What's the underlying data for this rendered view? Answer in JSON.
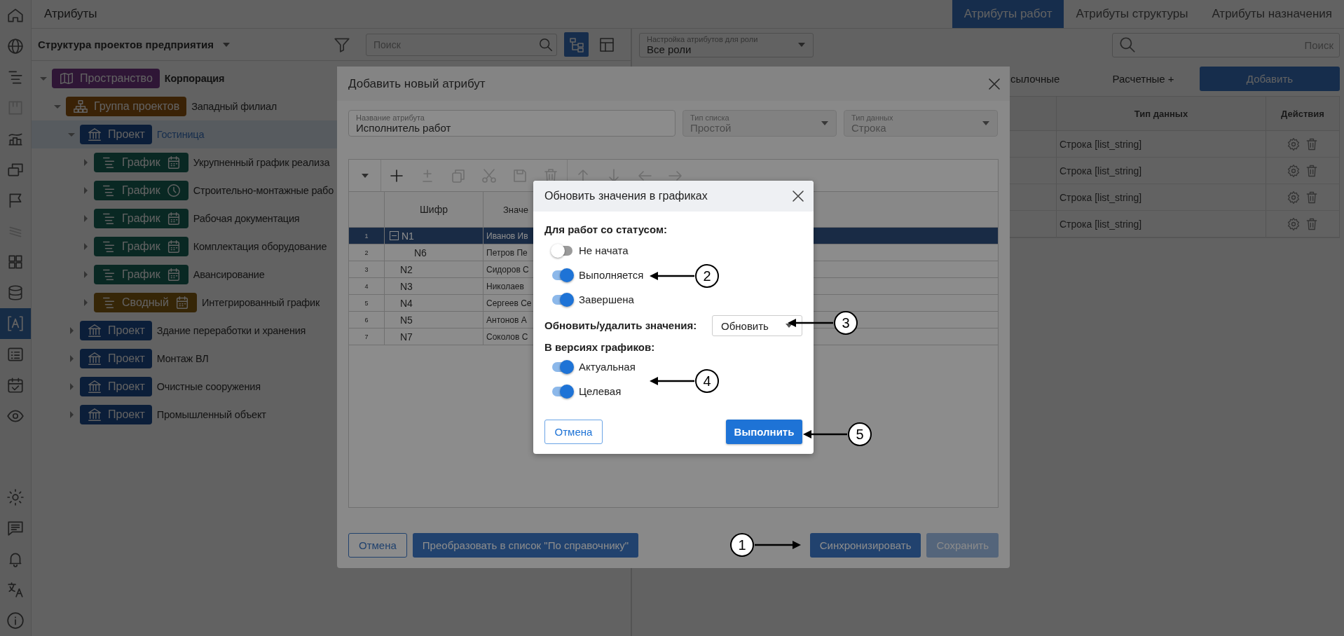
{
  "header": {
    "title": "Атрибуты",
    "tabs": [
      {
        "label": "Атрибуты работ",
        "selected": true
      },
      {
        "label": "Атрибуты структуры",
        "selected": false
      },
      {
        "label": "Атрибуты назначения",
        "selected": false
      }
    ]
  },
  "sidebar": {
    "items": [
      {
        "selected": false,
        "disabled": false
      },
      {
        "selected": false,
        "disabled": false
      },
      {
        "selected": false,
        "disabled": false
      },
      {
        "selected": false,
        "disabled": true
      },
      {
        "selected": false,
        "disabled": false
      },
      {
        "selected": false,
        "disabled": false
      },
      {
        "selected": false,
        "disabled": false
      },
      {
        "selected": false,
        "disabled": true
      },
      {
        "selected": false,
        "disabled": false
      },
      {
        "selected": false,
        "disabled": false
      },
      {
        "selected": true,
        "disabled": false
      },
      {
        "selected": false,
        "disabled": false
      },
      {
        "selected": false,
        "disabled": false
      },
      {
        "selected": false,
        "disabled": false
      }
    ]
  },
  "left_panel": {
    "structure_selector": "Структура проектов предприятия",
    "search": {
      "placeholder": "Поиск"
    },
    "view_toggle": [
      {
        "selected": true
      },
      {
        "selected": false
      }
    ],
    "tree": [
      {
        "kind": "space",
        "badge": "Пространство",
        "label": "Корпорация",
        "expanded": true,
        "selected": false,
        "children": [
          {
            "kind": "group",
            "badge": "Группа проектов",
            "label": "Западный филиал",
            "expanded": true,
            "selected": false,
            "children": [
              {
                "kind": "project",
                "badge": "Проект",
                "label": "Гостиница",
                "expanded": true,
                "selected": true,
                "children": [
                  {
                    "kind": "schedule",
                    "badge": "График",
                    "label": "Укрупненный график реализа",
                    "expanded": false,
                    "selected": false
                  },
                  {
                    "kind": "schedule-clock",
                    "badge": "График",
                    "label": "Строительно-монтажные рабо",
                    "expanded": false,
                    "selected": false
                  },
                  {
                    "kind": "schedule",
                    "badge": "График",
                    "label": "Рабочая документация",
                    "expanded": false,
                    "selected": false
                  },
                  {
                    "kind": "schedule",
                    "badge": "График",
                    "label": "Комплектация оборудование",
                    "expanded": false,
                    "selected": false
                  },
                  {
                    "kind": "schedule",
                    "badge": "График",
                    "label": "Авансирование",
                    "expanded": false,
                    "selected": false
                  },
                  {
                    "kind": "summary",
                    "badge": "Сводный",
                    "label": "Интегрированный график",
                    "expanded": false,
                    "selected": false
                  }
                ]
              },
              {
                "kind": "project",
                "badge": "Проект",
                "label": "Здание переработки и хранения",
                "expanded": false,
                "selected": false
              },
              {
                "kind": "project",
                "badge": "Проект",
                "label": "Монтаж ВЛ",
                "expanded": false,
                "selected": false
              },
              {
                "kind": "project",
                "badge": "Проект",
                "label": "Очистные сооружения",
                "expanded": false,
                "selected": false
              },
              {
                "kind": "project",
                "badge": "Проект",
                "label": "Промышленный объект",
                "expanded": false,
                "selected": false
              }
            ]
          }
        ]
      }
    ]
  },
  "right_panel": {
    "role_filter": {
      "label": "Настройка атрибутов для роли",
      "value": "Все роли"
    },
    "search": {
      "placeholder": "Поиск"
    },
    "filters": [
      "сылочные",
      "Расчетные +"
    ],
    "add_button": "Добавить",
    "table": {
      "columns": [
        "Тип данных",
        "Действия"
      ],
      "rows": [
        {
          "data_type": "Строка [list_string]"
        },
        {
          "data_type": "Строка [list_string]"
        },
        {
          "data_type": "Строка [list_string]"
        },
        {
          "data_type": "Строка [list_string]"
        }
      ]
    }
  },
  "attribute_dialog": {
    "title": "Добавить новый атрибут",
    "fields": [
      {
        "label": "Название атрибута",
        "value": "Исполнитель работ",
        "kind": "text",
        "disabled": false
      },
      {
        "label": "Тип списка",
        "value": "Простой",
        "kind": "select",
        "disabled": true
      },
      {
        "label": "Тип данных",
        "value": "Строка",
        "kind": "select",
        "disabled": true
      }
    ],
    "grid": {
      "columns": [
        "Шифр",
        "Значе"
      ],
      "rows": [
        {
          "num": "1",
          "code": "N1",
          "value": "Иванов Ив",
          "selected": true,
          "expanded": true,
          "children": [
            {
              "num": "2",
              "code": "N6",
              "value": "Петров Пе",
              "selected": false
            }
          ]
        },
        {
          "num": "3",
          "code": "N2",
          "value": "Сидоров С",
          "selected": false
        },
        {
          "num": "4",
          "code": "N3",
          "value": "Николаев",
          "selected": false
        },
        {
          "num": "5",
          "code": "N4",
          "value": "Сергеев Се",
          "selected": false
        },
        {
          "num": "6",
          "code": "N5",
          "value": "Антонов А",
          "selected": false
        },
        {
          "num": "7",
          "code": "N7",
          "value": "Соколов С",
          "selected": false
        }
      ]
    },
    "buttons_left": [
      {
        "label": "Отмена",
        "kind": "outline",
        "disabled": false
      },
      {
        "label": "Преобразовать в список \"По справочнику\"",
        "kind": "primary",
        "disabled": false
      }
    ],
    "buttons_right": [
      {
        "label": "Синхронизировать",
        "kind": "primary",
        "disabled": false
      },
      {
        "label": "Сохранить",
        "kind": "primary",
        "disabled": true
      }
    ]
  },
  "update_dialog": {
    "title": "Обновить значения в графиках",
    "status_label": "Для работ со статусом:",
    "statuses": [
      {
        "label": "Не начата",
        "on": false
      },
      {
        "label": "Выполняется",
        "on": true
      },
      {
        "label": "Завершена",
        "on": true
      }
    ],
    "action_label": "Обновить/удалить значения:",
    "action_value": "Обновить",
    "versions_label": "В версиях графиков:",
    "versions": [
      {
        "label": "Актуальная",
        "on": true
      },
      {
        "label": "Целевая",
        "on": true
      }
    ],
    "cancel": "Отмена",
    "submit": "Выполнить"
  },
  "callouts": [
    {
      "number": "1"
    },
    {
      "number": "2"
    },
    {
      "number": "3"
    },
    {
      "number": "4"
    },
    {
      "number": "5"
    }
  ]
}
